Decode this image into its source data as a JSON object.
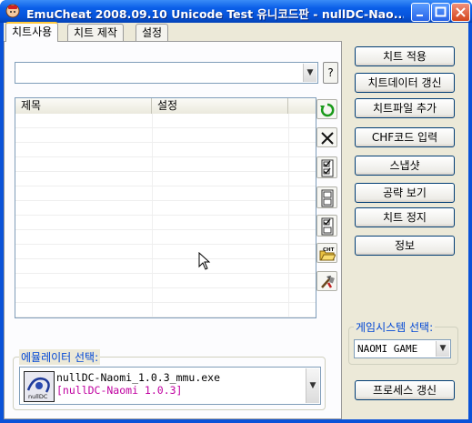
{
  "window": {
    "title": "EmuCheat  2008.09.10 Unicode Test 유니코드판 - nullDC-Nao..."
  },
  "tabs": [
    {
      "label": "치트사용",
      "active": true
    },
    {
      "label": "치트 제작",
      "active": false
    },
    {
      "label": "설정",
      "active": false
    }
  ],
  "cheat_combo": {
    "value": "",
    "help_label": "?"
  },
  "list": {
    "columns": [
      "제목",
      "설정"
    ],
    "rows": []
  },
  "side_icons": [
    {
      "name": "refresh-icon"
    },
    {
      "name": "delete-icon"
    },
    {
      "name": "check-all-icon"
    },
    {
      "name": "uncheck-all-icon"
    },
    {
      "name": "toggle-check-icon"
    },
    {
      "name": "open-cht-file-icon",
      "text": "CHT"
    },
    {
      "name": "tools-icon"
    }
  ],
  "buttons": {
    "apply": "치트 적용",
    "update_data": "치트데이터 갱신",
    "add_file": "치트파일 추가",
    "chf_input": "CHF코드 입력",
    "snapshot": "스냅샷",
    "walkthrough": "공략 보기",
    "stop": "치트 정지",
    "info": "정보",
    "refresh_process": "프로세스 갱신"
  },
  "emulator": {
    "group_label": "에뮬레이터 선택:",
    "exe": "nullDC-Naomi_1.0.3_mmu.exe",
    "version": "[nullDC-Naomi 1.0.3]",
    "logo_text": "nullDC"
  },
  "game_system": {
    "group_label": "게임시스템 선택:",
    "selected": "NAOMI GAME"
  },
  "colors": {
    "titlebar": "#0654dc",
    "version_text": "#c000a0",
    "group_label": "#0046d5"
  }
}
